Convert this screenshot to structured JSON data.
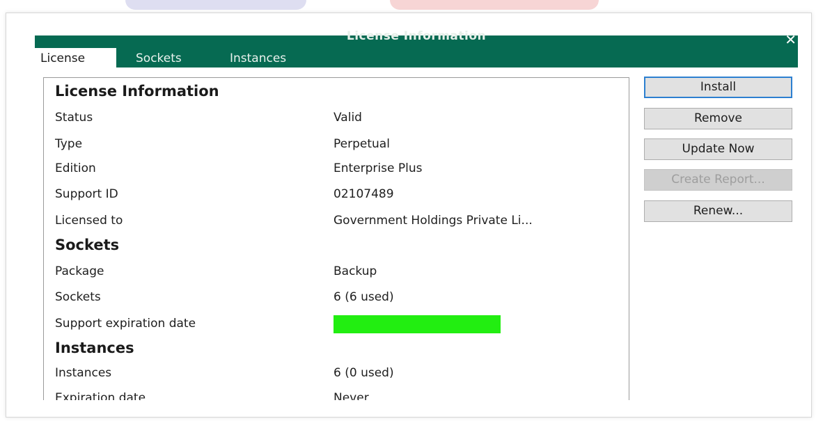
{
  "window": {
    "title": "License Information",
    "close_glyph": "✕"
  },
  "tabs": [
    "License",
    "Sockets",
    "Instances"
  ],
  "license_info": {
    "heading": "License Information",
    "rows": [
      {
        "label": "Status",
        "value": "Valid"
      },
      {
        "label": "Type",
        "value": "Perpetual"
      },
      {
        "label": "Edition",
        "value": "Enterprise Plus"
      },
      {
        "label": "Support ID",
        "value": "02107489"
      },
      {
        "label": "Licensed to",
        "value": "Government Holdings Private Li..."
      }
    ]
  },
  "sockets": {
    "heading": "Sockets",
    "rows": [
      {
        "label": "Package",
        "value": "Backup"
      },
      {
        "label": "Sockets",
        "value": "6 (6 used)"
      },
      {
        "label": "Support expiration date",
        "value": ""
      }
    ]
  },
  "instances": {
    "heading": "Instances",
    "rows": [
      {
        "label": "Instances",
        "value": "6 (0 used)"
      },
      {
        "label": "Expiration date",
        "value": "Never"
      }
    ]
  },
  "buttons": {
    "install": "Install",
    "remove": "Remove",
    "update_now": "Update Now",
    "create_report": "Create Report...",
    "renew": "Renew..."
  },
  "colors": {
    "titlebar": "#066a52",
    "redaction": "#22ee11",
    "focus_border": "#2c7fd0"
  },
  "icons": {
    "close": "close-icon"
  }
}
